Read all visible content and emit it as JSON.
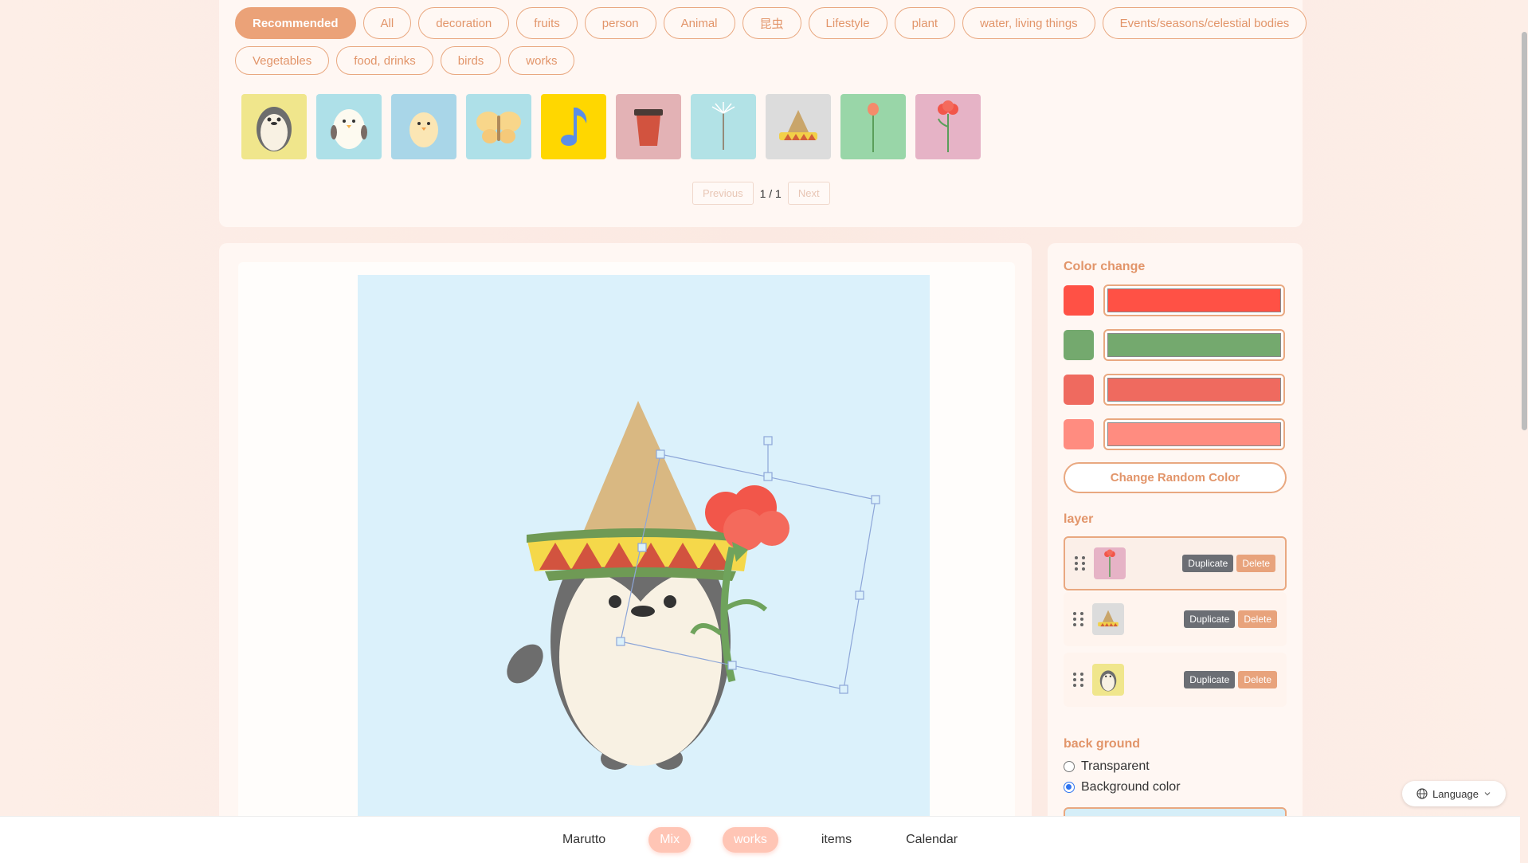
{
  "categories": {
    "row1": [
      "Recommended",
      "All",
      "decoration",
      "fruits",
      "person",
      "Animal",
      "昆虫",
      "Lifestyle",
      "plant",
      "water, living things",
      "Events/seasons/celestial bodies"
    ],
    "row2": [
      "Vegetables",
      "food, drinks",
      "birds",
      "works"
    ],
    "active": "Recommended"
  },
  "thumbnails": [
    {
      "name": "penguin-icon",
      "bg": "#f0e68c"
    },
    {
      "name": "bird-icon",
      "bg": "#aee0e8"
    },
    {
      "name": "chick-icon",
      "bg": "#a9d6e8"
    },
    {
      "name": "butterfly-icon",
      "bg": "#aee0e8"
    },
    {
      "name": "music-note-icon",
      "bg": "#ffd700"
    },
    {
      "name": "cup-icon",
      "bg": "#e3b2b5"
    },
    {
      "name": "dandelion-icon",
      "bg": "#b2e2e6"
    },
    {
      "name": "sombrero-icon",
      "bg": "#dcdcdc"
    },
    {
      "name": "tulip-icon",
      "bg": "#99d6a8"
    },
    {
      "name": "carnation-icon",
      "bg": "#e6b3c6"
    }
  ],
  "pager": {
    "previous": "Previous",
    "page": "1 / 1",
    "next": "Next"
  },
  "side": {
    "color_title": "Color change",
    "colors": [
      "#ff5145",
      "#74a96e",
      "#ef6a5f",
      "#ff8c80"
    ],
    "random_label": "Change Random Color",
    "layer_title": "layer",
    "layers": [
      {
        "thumb": "carnation-icon",
        "thumb_bg": "#e6b3c6",
        "duplicate": "Duplicate",
        "delete": "Delete",
        "active": true
      },
      {
        "thumb": "sombrero-icon",
        "thumb_bg": "#dcdcdc",
        "duplicate": "Duplicate",
        "delete": "Delete",
        "active": false
      },
      {
        "thumb": "penguin-icon",
        "thumb_bg": "#f0e68c",
        "duplicate": "Duplicate",
        "delete": "Delete",
        "active": false
      }
    ],
    "bg_title": "back ground",
    "bg_transparent": "Transparent",
    "bg_color": "Background color"
  },
  "language": "Language",
  "nav": [
    "Marutto",
    "Mix",
    "works",
    "items",
    "Calendar"
  ]
}
